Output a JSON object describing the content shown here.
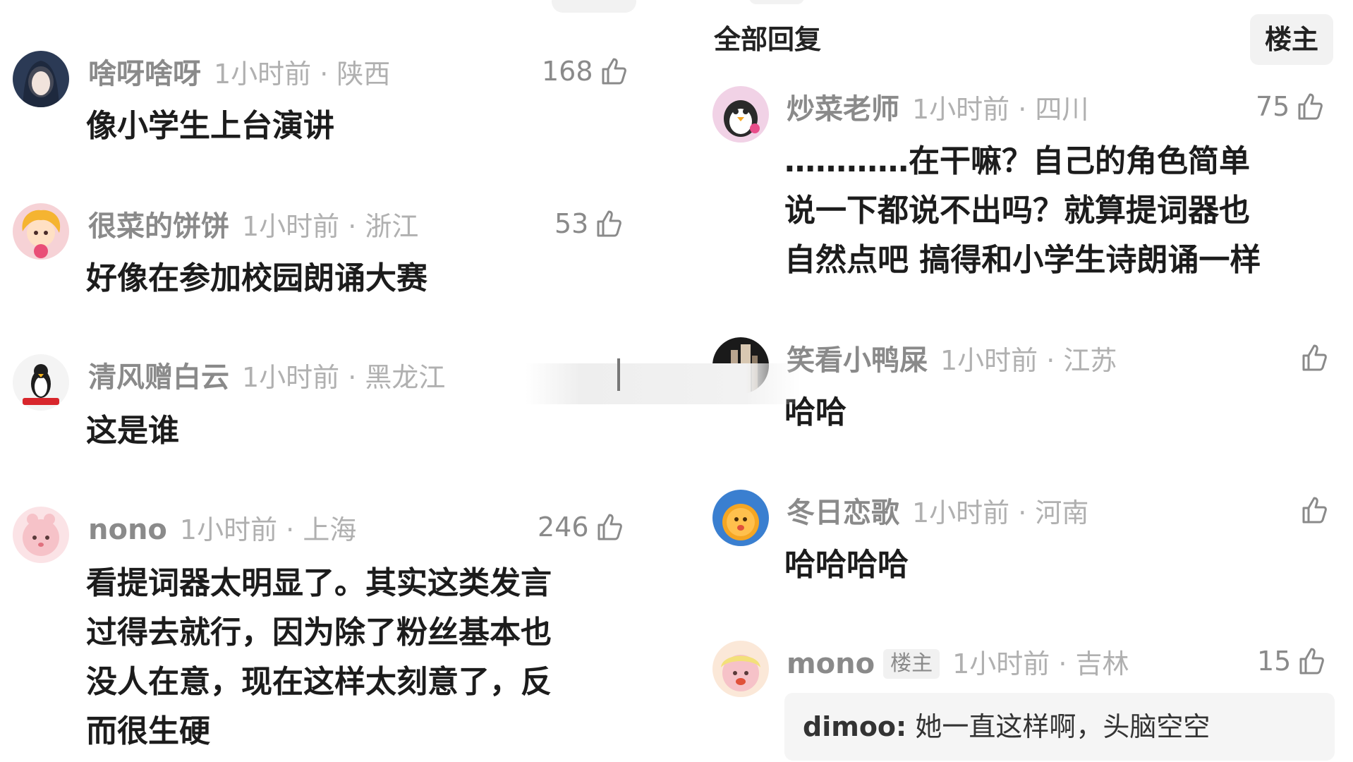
{
  "left_comments": [
    {
      "username": "啥呀啥呀",
      "time_location": "1小时前 · 陕西",
      "likes": "168",
      "text_lines": [
        "像小学生上台演讲"
      ]
    },
    {
      "username": "很菜的饼饼",
      "time_location": "1小时前 · 浙江",
      "likes": "53",
      "text_lines": [
        "好像在参加校园朗诵大赛"
      ]
    },
    {
      "username": "清风赠白云",
      "time_location": "1小时前 · 黑龙江",
      "likes": "",
      "text_lines": [
        "这是谁"
      ]
    },
    {
      "username": "nono",
      "time_location": "1小时前 · 上海",
      "likes": "246",
      "text_lines": [
        "看提词器太明显了。其实这类发言",
        "过得去就行，因为除了粉丝基本也",
        "没人在意，现在这样太刻意了，反",
        "而很生硬"
      ]
    }
  ],
  "right_header": {
    "title": "全部回复",
    "op_filter": "楼主"
  },
  "right_comments": [
    {
      "username": "炒菜老师",
      "time_location": "1小时前 · 四川",
      "likes": "75",
      "text_lines": [
        "…………在干嘛？自己的角色简单",
        "说一下都说不出吗？就算提词器也",
        "自然点吧 搞得和小学生诗朗诵一样"
      ]
    },
    {
      "username": "笑看小鸭屎",
      "time_location": "1小时前 · 江苏",
      "likes": "",
      "text_lines": [
        "哈哈"
      ]
    },
    {
      "username": "冬日恋歌",
      "time_location": "1小时前 · 河南",
      "likes": "",
      "text_lines": [
        "哈哈哈哈"
      ]
    },
    {
      "username": "mono",
      "badge": "楼主",
      "time_location": "1小时前 · 吉林",
      "likes": "15",
      "reply": {
        "name": "dimoo:",
        "text": "她一直这样啊，头脑空空"
      }
    }
  ],
  "icons": {
    "like": "thumbs-up-icon",
    "avatar": "avatar"
  },
  "colors": {
    "username": "#8a8a8a",
    "meta": "#b0b0b0",
    "text": "#1c1c1c",
    "chip_bg": "#f2f2f2"
  }
}
